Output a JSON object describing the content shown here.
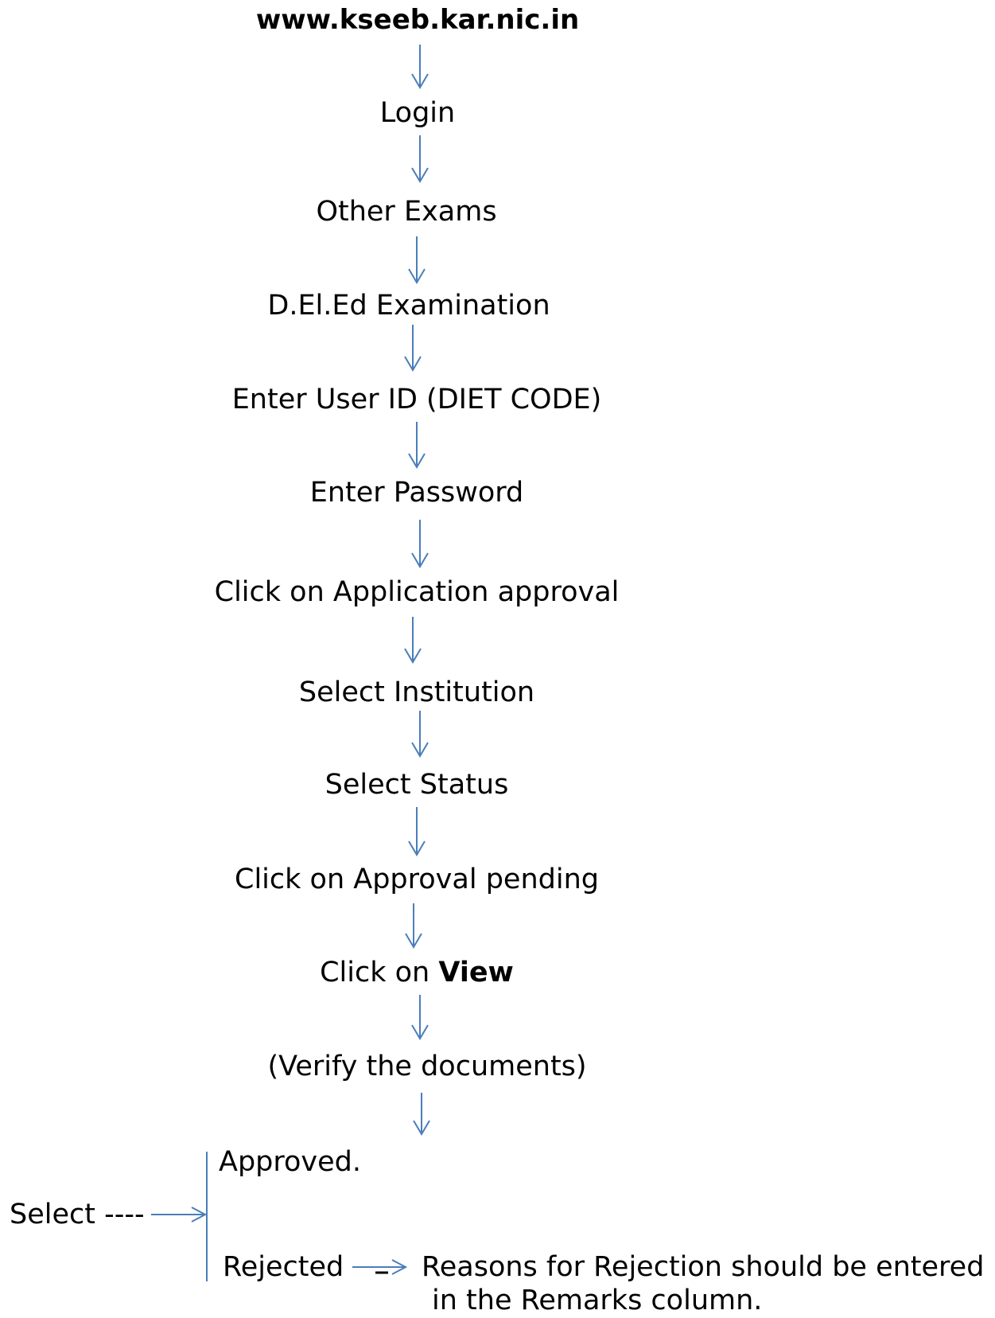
{
  "steps": {
    "url": "www.kseeb.kar.nic.in",
    "login": "Login",
    "other_exams": "Other Exams",
    "deled": "D.El.Ed Examination",
    "user_id": "Enter User ID (DIET CODE)",
    "password": "Enter Password",
    "app_approval": "Click on Application approval",
    "institution": "Select Institution",
    "status": "Select Status",
    "approval_pending": "Click on Approval pending",
    "view_prefix": "Click on ",
    "view_bold": "View",
    "verify": "(Verify the documents)"
  },
  "branch": {
    "select": "Select ----",
    "approved": "Approved.",
    "rejected": "Rejected",
    "reason_line1": "Reasons for Rejection should be entered",
    "reason_line2": "in the Remarks column."
  },
  "colors": {
    "arrow": "#4a7ebb",
    "text": "#000000"
  }
}
